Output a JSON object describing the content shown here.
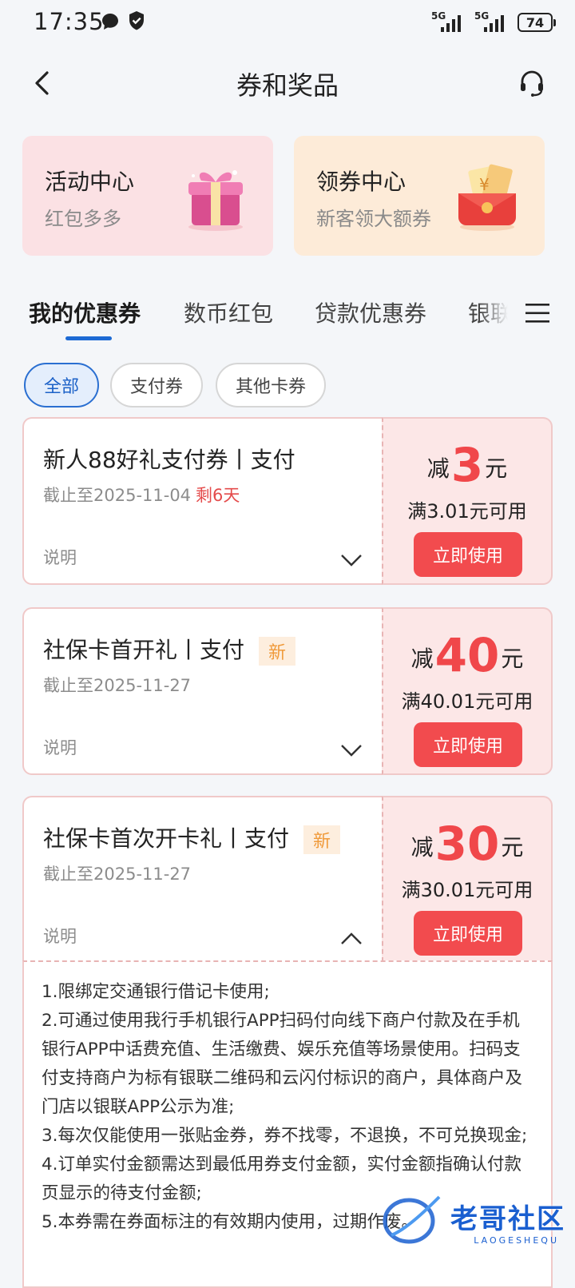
{
  "status_bar": {
    "time": "17:35",
    "network_1": "5G",
    "network_2": "5G",
    "battery": "74",
    "icons": [
      "message-icon",
      "shield-icon",
      "signal-icon",
      "battery-icon"
    ]
  },
  "header": {
    "title": "券和奖品",
    "back_icon": "chevron-left-icon",
    "service_icon": "headset-icon"
  },
  "promos": [
    {
      "title": "活动中心",
      "subtitle": "红包多多",
      "icon": "gift-box-icon",
      "bg": "#fbe1e4"
    },
    {
      "title": "领券中心",
      "subtitle": "新客领大额券",
      "icon": "red-envelope-icon",
      "bg": "#fdebd8"
    }
  ],
  "tabs": {
    "items": [
      "我的优惠券",
      "数币红包",
      "贷款优惠券",
      "银联"
    ],
    "active": "我的优惠券",
    "menu_icon": "menu-icon"
  },
  "filters": {
    "items": [
      "全部",
      "支付券",
      "其他卡券"
    ],
    "active": "全部"
  },
  "coupons": [
    {
      "title": "新人88好礼支付券丨支付",
      "date": "截止至2025-11-04",
      "remain": "剩6天",
      "explain": "说明",
      "prefix": "减",
      "amount": "3",
      "unit": "元",
      "min": "满3.01元可用",
      "button": "立即使用",
      "expanded": false
    },
    {
      "title": "社保卡首开礼丨支付",
      "badge": "新",
      "date": "截止至2025-11-27",
      "explain": "说明",
      "prefix": "减",
      "amount": "40",
      "unit": "元",
      "min": "满40.01元可用",
      "button": "立即使用",
      "expanded": false
    },
    {
      "title": "社保卡首次开卡礼丨支付",
      "badge": "新",
      "date": "截止至2025-11-27",
      "explain": "说明",
      "prefix": "减",
      "amount": "30",
      "unit": "元",
      "min": "满30.01元可用",
      "button": "立即使用",
      "expanded": true
    }
  ],
  "description": {
    "lines": [
      "1.限绑定交通银行借记卡使用;",
      "2.可通过使用我行手机银行APP扫码付向线下商户付款及在手机银行APP中话费充值、生活缴费、娱乐充值等场景使用。扫码支付支持商户为标有银联二维码和云闪付标识的商户，具体商户及门店以银联APP公示为准;",
      "3.每次仅能使用一张贴金券，券不找零，不退换，不可兑换现金;",
      "4.订单实付金额需达到最低用券支付金额，实付金额指确认付款页显示的待支付金额;",
      "5.本券需在券面标注的有效期内使用，过期作废。"
    ]
  },
  "watermark": {
    "text": "老哥社区",
    "sub": "LAOGESHEQU"
  },
  "colors": {
    "accent_blue": "#1d6ad4",
    "coupon_red": "#f24b4e",
    "badge_orange": "#f09a3a"
  }
}
